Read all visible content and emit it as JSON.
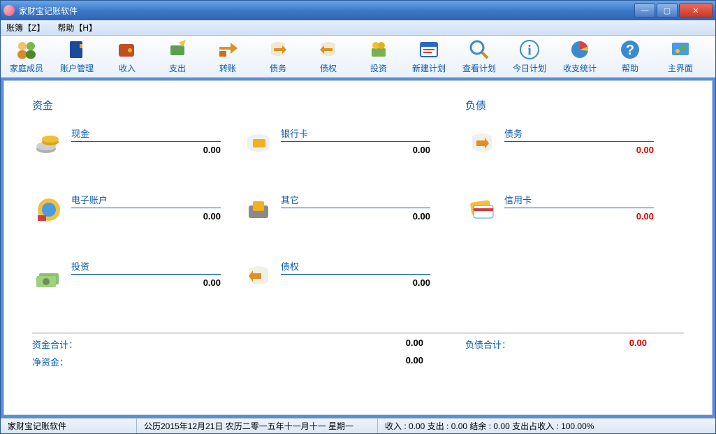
{
  "window": {
    "title": "家财宝记账软件"
  },
  "menu": {
    "ledger": "账簿【Z】",
    "help": "帮助【H】"
  },
  "toolbar": [
    {
      "id": "family",
      "label": "家庭成员"
    },
    {
      "id": "accounts",
      "label": "账户管理"
    },
    {
      "id": "income",
      "label": "收入"
    },
    {
      "id": "expense",
      "label": "支出"
    },
    {
      "id": "transfer",
      "label": "转账"
    },
    {
      "id": "debt",
      "label": "债务"
    },
    {
      "id": "credit",
      "label": "债权"
    },
    {
      "id": "invest",
      "label": "投资"
    },
    {
      "id": "newplan",
      "label": "新建计划"
    },
    {
      "id": "viewplan",
      "label": "查看计划"
    },
    {
      "id": "todayplan",
      "label": "今日计划"
    },
    {
      "id": "stats",
      "label": "收支统计"
    },
    {
      "id": "helpbtn",
      "label": "帮助"
    },
    {
      "id": "main",
      "label": "主界面"
    }
  ],
  "sections": {
    "assets": {
      "title": "资金",
      "items": [
        {
          "id": "cash",
          "label": "现金",
          "value": "0.00"
        },
        {
          "id": "bankcard",
          "label": "银行卡",
          "value": "0.00"
        },
        {
          "id": "eaccount",
          "label": "电子账户",
          "value": "0.00"
        },
        {
          "id": "other",
          "label": "其它",
          "value": "0.00"
        },
        {
          "id": "invest",
          "label": "投资",
          "value": "0.00"
        },
        {
          "id": "creditr",
          "label": "债权",
          "value": "0.00"
        }
      ]
    },
    "debts": {
      "title": "负债",
      "items": [
        {
          "id": "debt",
          "label": "债务",
          "value": "0.00"
        },
        {
          "id": "creditcard",
          "label": "信用卡",
          "value": "0.00"
        }
      ]
    }
  },
  "totals": {
    "assets_label": "资金合计：",
    "assets_value": "0.00",
    "debts_label": "负债合计：",
    "debts_value": "0.00",
    "net_label": "净资金：",
    "net_value": "0.00"
  },
  "status": {
    "app": "家财宝记账软件",
    "date": "公历2015年12月21日 农历二零一五年十一月十一  星期一",
    "summary": "收入 : 0.00 支出 : 0.00 结余 : 0.00 支出占收入 : 100.00%"
  }
}
